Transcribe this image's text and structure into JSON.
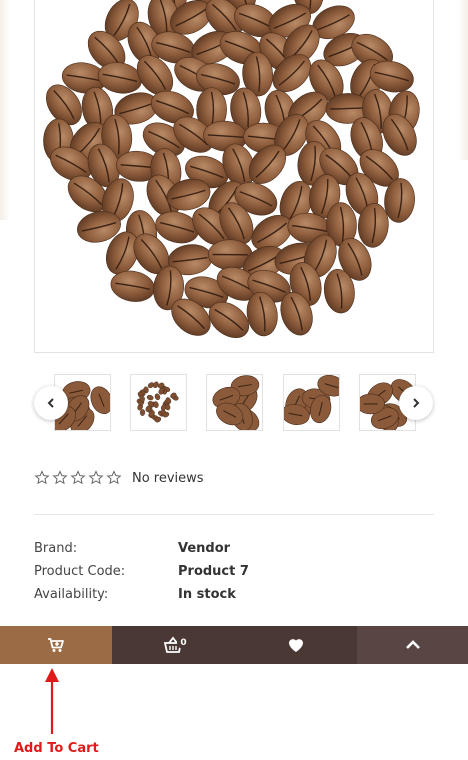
{
  "product": {
    "rating_stars": 0,
    "reviews_text": "No reviews",
    "specs": [
      {
        "label": "Brand:",
        "value": "Vendor"
      },
      {
        "label": "Product Code:",
        "value": "Product 7"
      },
      {
        "label": "Availability:",
        "value": "In stock"
      }
    ]
  },
  "bottom_bar": {
    "cart_count": "0",
    "colors": {
      "add_to_cart": "#9a6b45",
      "cart": "#4a3834",
      "wishlist": "#4a3834",
      "top": "#5a4545"
    }
  },
  "annotation": {
    "label": "Add To Cart",
    "color": "#e01a1a"
  }
}
